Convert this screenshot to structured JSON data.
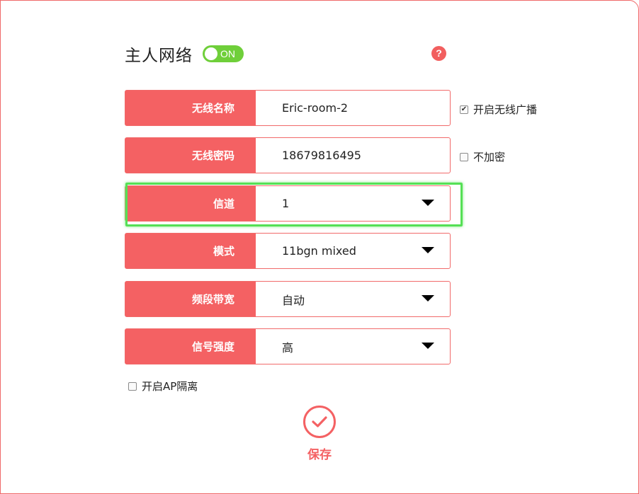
{
  "header": {
    "title": "主人网络",
    "toggle_label": "ON",
    "help_symbol": "?"
  },
  "form": {
    "rows": [
      {
        "label": "无线名称",
        "value": "Eric-room-2",
        "kind": "input"
      },
      {
        "label": "无线密码",
        "value": "18679816495",
        "kind": "input"
      },
      {
        "label": "信道",
        "value": "1",
        "kind": "select"
      },
      {
        "label": "模式",
        "value": "11bgn mixed",
        "kind": "select"
      },
      {
        "label": "频段带宽",
        "value": "自动",
        "kind": "select"
      },
      {
        "label": "信号强度",
        "value": "高",
        "kind": "select"
      }
    ],
    "options": {
      "broadcast": {
        "label": "开启无线广播",
        "checked": true
      },
      "no_encrypt": {
        "label": "不加密",
        "checked": false
      },
      "ap_isolation": {
        "label": "开启AP隔离",
        "checked": false
      }
    }
  },
  "actions": {
    "save_label": "保存"
  },
  "colors": {
    "accent": "#f46163",
    "toggle_on": "#6fcf3a",
    "highlight": "#55e055"
  },
  "icons": {
    "help": "question-circle-icon",
    "select": "caret-down-icon",
    "save": "check-circle-icon"
  }
}
